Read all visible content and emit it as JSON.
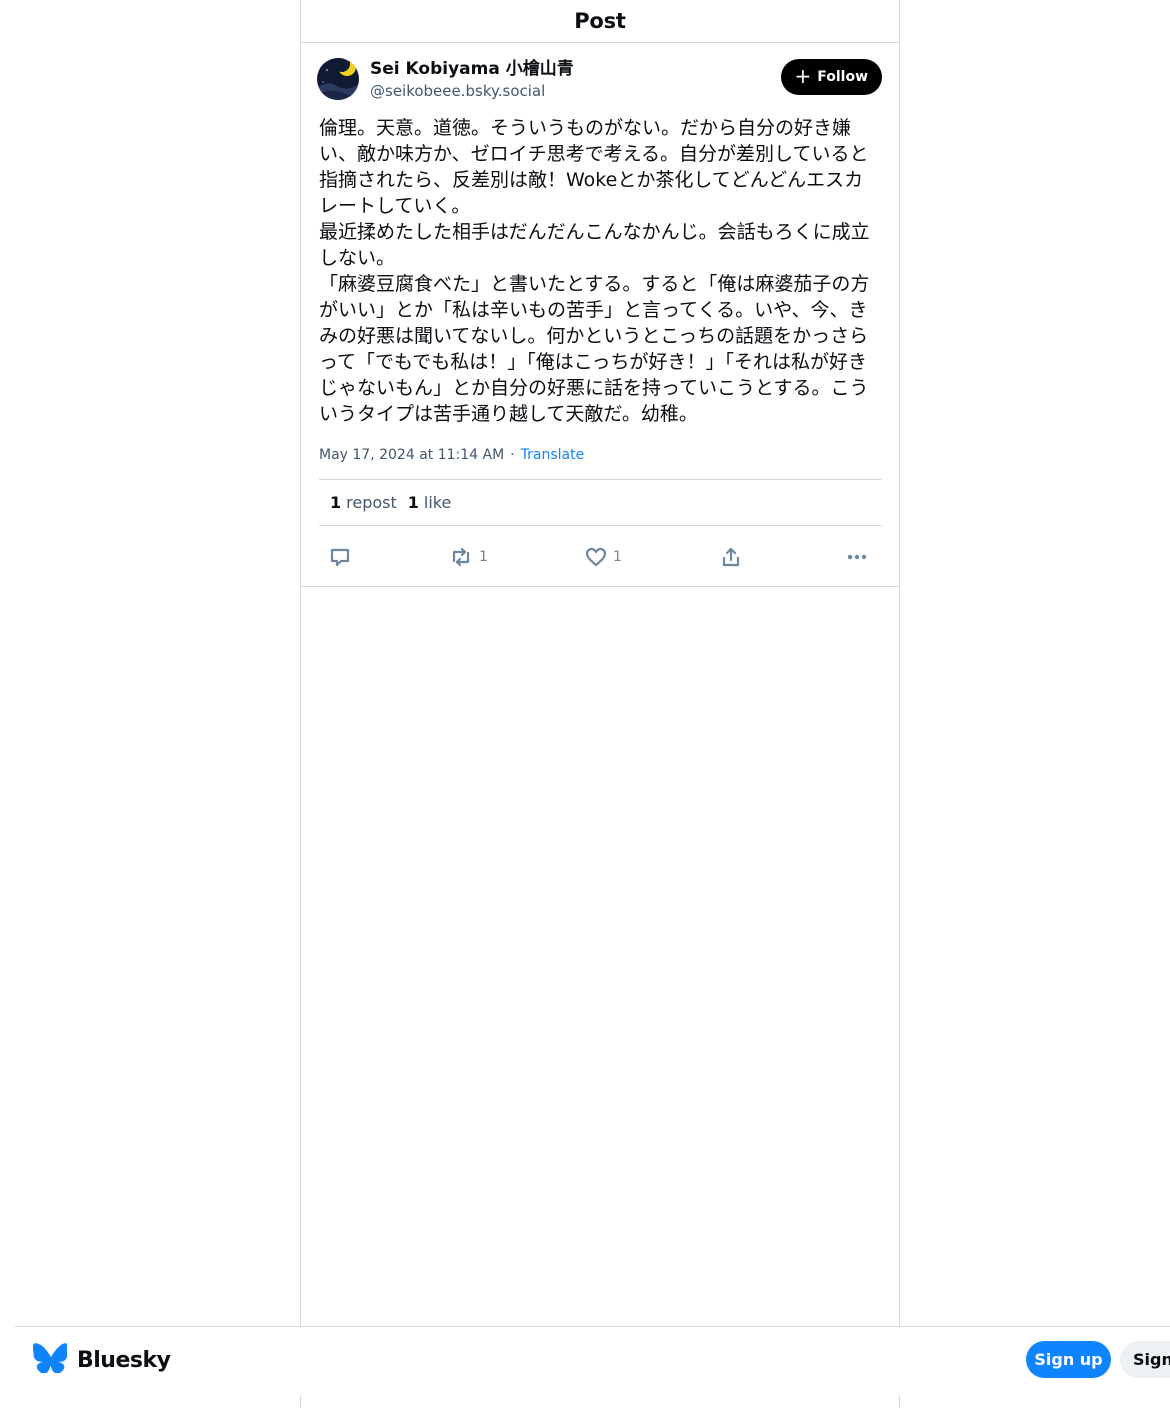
{
  "header": {
    "title": "Post"
  },
  "post": {
    "author": {
      "display_name": "Sei Kobiyama 小檜山青",
      "handle": "@seikobeee.bsky.social"
    },
    "follow_label": "Follow",
    "text": "倫理。天意。道徳。そういうものがない。だから自分の好き嫌い、敵か味方か、ゼロイチ思考で考える。自分が差別していると指摘されたら、反差別は敵！Wokeとか茶化してどんどんエスカレートしていく。\n最近揉めたした相手はだんだんこんなかんじ。会話もろくに成立しない。\n「麻婆豆腐食べた」と書いたとする。すると「俺は麻婆茄子の方がいい」とか「私は辛いもの苦手」と言ってくる。いや、今、きみの好悪は聞いてないし。何かというとこっちの話題をかっさらって「でもでも私は！」「俺はこっちが好き！」「それは私が好きじゃないもん」とか自分の好悪に話を持っていこうとする。こういうタイプは苦手通り越して天敵だ。幼稚。",
    "timestamp": "May 17, 2024 at 11:14 AM",
    "separator": "·",
    "translate_label": "Translate",
    "stats": {
      "reposts_count": "1",
      "reposts_label": "repost",
      "likes_count": "1",
      "likes_label": "like"
    },
    "actions": {
      "reply_icon": "speech-bubble-icon",
      "repost_icon": "repost-arrows-icon",
      "repost_count": "1",
      "like_icon": "heart-icon",
      "like_count": "1",
      "share_icon": "share-upload-icon",
      "more_icon": "ellipsis-icon"
    }
  },
  "bottom_bar": {
    "brand_name": "Bluesky",
    "signup_label": "Sign up",
    "signin_label": "Sign in"
  },
  "colors": {
    "accent": "#1083fe",
    "border": "#d4dbe2",
    "muted_text": "#42576c",
    "icon_gray": "#6f869f"
  }
}
